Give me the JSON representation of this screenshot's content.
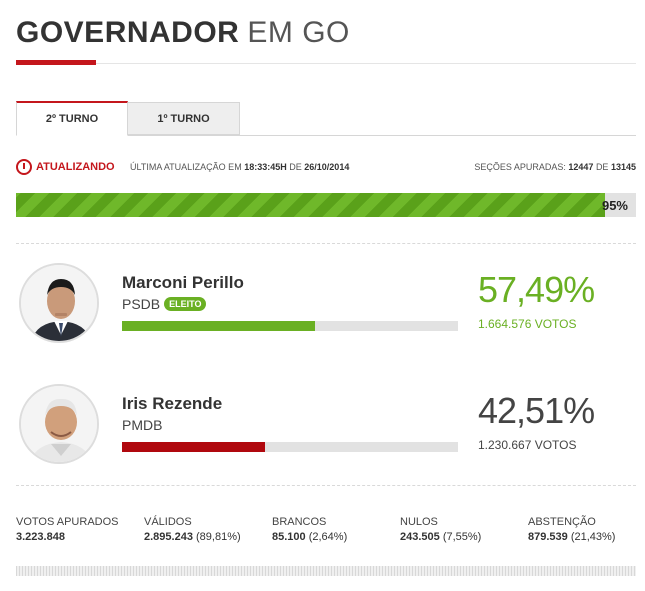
{
  "header": {
    "title_strong": "GOVERNADOR",
    "title_light": "EM GO"
  },
  "tabs": [
    {
      "label": "2º TURNO",
      "active": true
    },
    {
      "label": "1º TURNO",
      "active": false
    }
  ],
  "status": {
    "live_label": "ATUALIZANDO",
    "update_prefix": "ÚLTIMA ATUALIZAÇÃO EM",
    "update_time": "18:33:45H",
    "update_mid": "DE",
    "update_date": "26/10/2014",
    "sections_prefix": "SEÇÕES APURADAS:",
    "sections_counted": "12447",
    "sections_mid": "DE",
    "sections_total": "13145"
  },
  "progress": {
    "label": "95%",
    "fraction": 0.95,
    "color": "#5aa11a"
  },
  "candidates": [
    {
      "name": "Marconi Perillo",
      "party": "PSDB",
      "badge": "ELEITO",
      "percent": "57,49%",
      "votes": "1.664.576 VOTOS",
      "share": 0.5749,
      "color": "#6ab023"
    },
    {
      "name": "Iris Rezende",
      "party": "PMDB",
      "badge": "",
      "percent": "42,51%",
      "votes": "1.230.667 VOTOS",
      "share": 0.4251,
      "color": "#b0080e"
    }
  ],
  "totals": [
    {
      "label": "VOTOS APURADOS",
      "value": "3.223.848",
      "extra": ""
    },
    {
      "label": "VÁLIDOS",
      "value": "2.895.243",
      "extra": "(89,81%)"
    },
    {
      "label": "BRANCOS",
      "value": "85.100",
      "extra": "(2,64%)"
    },
    {
      "label": "NULOS",
      "value": "243.505",
      "extra": "(7,55%)"
    },
    {
      "label": "ABSTENÇÃO",
      "value": "879.539",
      "extra": "(21,43%)"
    }
  ],
  "colors": {
    "brand_red": "#c4161c",
    "winner_green": "#6ab023",
    "loser_text": "#444444"
  }
}
